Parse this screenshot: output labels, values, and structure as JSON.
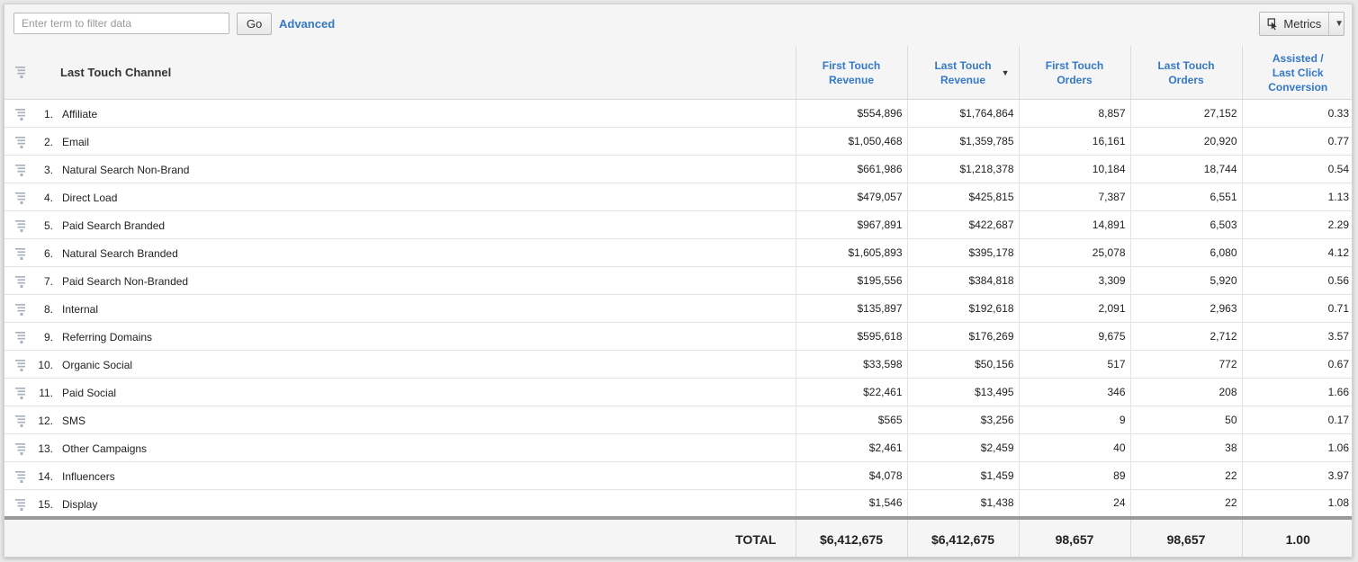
{
  "toolbar": {
    "filter_placeholder": "Enter term to filter data",
    "go_label": "Go",
    "advanced_label": "Advanced",
    "metrics_label": "Metrics"
  },
  "table": {
    "dimension_header": "Last Touch Channel",
    "metric_headers": [
      {
        "label": "First Touch Revenue",
        "lines": [
          "First Touch",
          "Revenue"
        ]
      },
      {
        "label": "Last Touch Revenue",
        "lines": [
          "Last Touch",
          "Revenue"
        ],
        "sorted": "desc"
      },
      {
        "label": "First Touch Orders",
        "lines": [
          "First Touch",
          "Orders"
        ]
      },
      {
        "label": "Last Touch Orders",
        "lines": [
          "Last Touch",
          "Orders"
        ]
      },
      {
        "label": "Assisted / Last Click Conversion",
        "lines": [
          "Assisted /",
          "Last Click",
          "Conversion"
        ]
      }
    ],
    "rows": [
      {
        "num": "1.",
        "name": "Affiliate",
        "values": [
          "$554,896",
          "$1,764,864",
          "8,857",
          "27,152",
          "0.33"
        ]
      },
      {
        "num": "2.",
        "name": "Email",
        "values": [
          "$1,050,468",
          "$1,359,785",
          "16,161",
          "20,920",
          "0.77"
        ]
      },
      {
        "num": "3.",
        "name": "Natural Search Non-Brand",
        "values": [
          "$661,986",
          "$1,218,378",
          "10,184",
          "18,744",
          "0.54"
        ]
      },
      {
        "num": "4.",
        "name": "Direct Load",
        "values": [
          "$479,057",
          "$425,815",
          "7,387",
          "6,551",
          "1.13"
        ]
      },
      {
        "num": "5.",
        "name": "Paid Search Branded",
        "values": [
          "$967,891",
          "$422,687",
          "14,891",
          "6,503",
          "2.29"
        ]
      },
      {
        "num": "6.",
        "name": "Natural Search Branded",
        "values": [
          "$1,605,893",
          "$395,178",
          "25,078",
          "6,080",
          "4.12"
        ]
      },
      {
        "num": "7.",
        "name": "Paid Search Non-Branded",
        "values": [
          "$195,556",
          "$384,818",
          "3,309",
          "5,920",
          "0.56"
        ]
      },
      {
        "num": "8.",
        "name": "Internal",
        "values": [
          "$135,897",
          "$192,618",
          "2,091",
          "2,963",
          "0.71"
        ]
      },
      {
        "num": "9.",
        "name": "Referring Domains",
        "values": [
          "$595,618",
          "$176,269",
          "9,675",
          "2,712",
          "3.57"
        ]
      },
      {
        "num": "10.",
        "name": "Organic Social",
        "values": [
          "$33,598",
          "$50,156",
          "517",
          "772",
          "0.67"
        ]
      },
      {
        "num": "11.",
        "name": "Paid Social",
        "values": [
          "$22,461",
          "$13,495",
          "346",
          "208",
          "1.66"
        ]
      },
      {
        "num": "12.",
        "name": "SMS",
        "values": [
          "$565",
          "$3,256",
          "9",
          "50",
          "0.17"
        ]
      },
      {
        "num": "13.",
        "name": "Other Campaigns",
        "values": [
          "$2,461",
          "$2,459",
          "40",
          "38",
          "1.06"
        ]
      },
      {
        "num": "14.",
        "name": "Influencers",
        "values": [
          "$4,078",
          "$1,459",
          "89",
          "22",
          "3.97"
        ]
      },
      {
        "num": "15.",
        "name": "Display",
        "values": [
          "$1,546",
          "$1,438",
          "24",
          "22",
          "1.08"
        ]
      }
    ],
    "total": {
      "label": "TOTAL",
      "values": [
        "$6,412,675",
        "$6,412,675",
        "98,657",
        "98,657",
        "1.00"
      ]
    }
  },
  "icons": {
    "breakdown": "breakdown-icon",
    "metrics": "cursor-select-icon",
    "sort": "sort-descending-icon"
  },
  "colors": {
    "link": "#3478c6",
    "header_bg": "#f5f5f5",
    "icon": "#aab3bd"
  }
}
